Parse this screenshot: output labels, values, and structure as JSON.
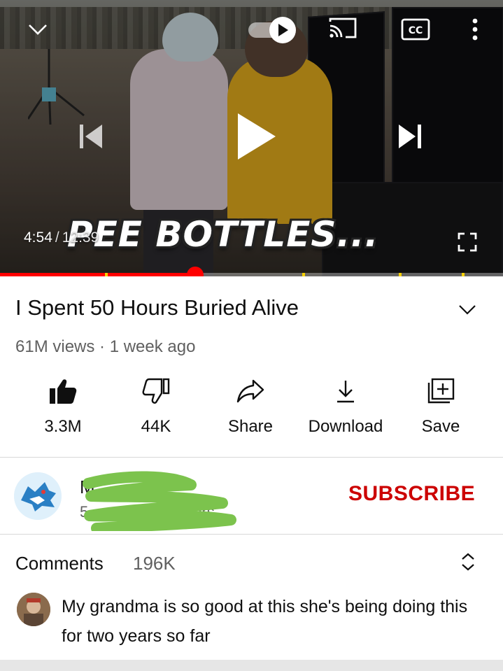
{
  "player": {
    "current_time": "4:54",
    "separator": "/",
    "duration": "12:39",
    "progress_fraction": 0.388,
    "overlay_caption": "PEE BOTTLES...",
    "cc_label": "CC",
    "colors": {
      "progress": "#ff0000",
      "chapter_marker": "#f5d000"
    }
  },
  "video": {
    "title": "I Spent 50 Hours Buried Alive",
    "meta": "61M views · 1 week ago"
  },
  "actions": [
    {
      "id": "like",
      "icon": "thumbs-up-icon",
      "label": "3.3M"
    },
    {
      "id": "dislike",
      "icon": "thumbs-down-icon",
      "label": "44K"
    },
    {
      "id": "share",
      "icon": "share-icon",
      "label": "Share"
    },
    {
      "id": "download",
      "icon": "download-icon",
      "label": "Download"
    },
    {
      "id": "save",
      "icon": "save-to-playlist-icon",
      "label": "Save"
    }
  ],
  "channel": {
    "name_visible": "M",
    "subs_visible": "5",
    "subs_suffix": "ers",
    "subscribe_label": "SUBSCRIBE",
    "colors": {
      "subscribe": "#cc0000",
      "redaction": "#7cc34d"
    }
  },
  "comments": {
    "heading": "Comments",
    "count": "196K",
    "top_comment": "My grandma is so good at this she's being doing this for two years so far"
  }
}
